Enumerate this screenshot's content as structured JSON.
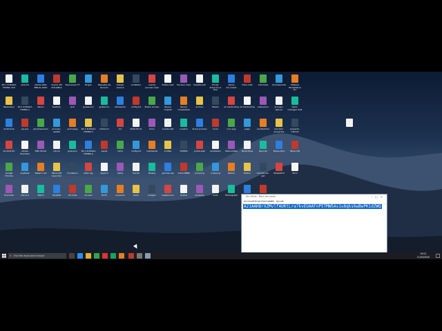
{
  "notepad": {
    "title": "Sin título - Bloc de notas",
    "menus": [
      "Archivo",
      "Edición",
      "Formato",
      "Ver",
      "Ayuda"
    ],
    "text": "A21AAH8rXZMvlfAUKtLra7kvEUAAFnP5TMW5As1u8qkskwBwPK1dZWQ",
    "selected": true
  },
  "taskbar": {
    "search_placeholder": "Escribe aquí para buscar",
    "clock_time": "19:01",
    "clock_date": "11/03/2020"
  },
  "desktop": {
    "wallpaper": "macOS Mojave night",
    "icons": [
      "SD 1.8 MAGIA FOMRA dmt",
      "sara.txt",
      "Adobe After Effects 2020",
      "Oracle VM VirtualBox",
      "Decisiones TT",
      "Brigas",
      "Paquetes de Servicio",
      "trabajo avance",
      "LockRetro",
      "cuenta proceso.mp4",
      "kidfier.mp4",
      "hxcvbvc.mp4",
      "bleeflet.pdf",
      "Enviar Dirección a Rios",
      "danes document",
      "fotos.mp4",
      "tutoriales",
      "Oculosquinta",
      "VMware Workstation Pro",
      "Newonbuy",
      "SD 1.8 MAGIA FOMRA.2",
      "Neuro",
      "Desktop",
      "arch",
      "guisasocio",
      "grabacion",
      "retrasando",
      "config.txt",
      "Buzón Acceso",
      "Nueva carpeta",
      "Nueva completada",
      "archivo",
      "Steam",
      "ok hardcoding",
      "ok.hardcoding",
      "evaluacion",
      "proceso-aplicac",
      "basic-manager.mp4",
      "dvdchamp",
      "pp-pos",
      "gmailresumen",
      "proceso-update",
      "pudvapeg",
      "SD 1.8 MAGIA FOMRA.3",
      "infoturno",
      "bd",
      "2020-05-21",
      "tomo",
      "cuenta-dist",
      "nuestra",
      "dreck-proceso",
      "tucia",
      "icon.png",
      "juego",
      "LandSertice",
      "borrador proyectos",
      "proyecto-tutorial",
      "Acrobat DC",
      "Adobe Premiere",
      "OBS Studio",
      "Canva",
      "guia-proc",
      "SD 1.8 MAGIA FOMRA.4",
      "sayas",
      "lamp",
      "config-bd",
      "cuentasxls",
      "kraftes",
      "TOMMA",
      "proba-web",
      "updatadoc",
      "Web-Ambas",
      "Nada Nova",
      "Recorte",
      "Brave.dmp",
      "Minecraft",
      "Google Chrome",
      "AnyDesk",
      "Steam Link",
      "Minecraft Launcher",
      "Fundasion",
      "latex.log",
      "sayas-2",
      "datos",
      "tienda",
      "fitoshp",
      "pendes-rep",
      "mesh-TBBB",
      "proxy.log",
      "nuha.png",
      "Retirar",
      "Firefox",
      "borradores-ppt",
      "Stopwatch",
      "Xbox",
      "Evernote",
      "Discord",
      "Twitch",
      "WinRAR",
      "VS Code",
      "ax-reso",
      "Mi PC",
      "proyecto",
      "texto",
      "Imagen",
      "nuestra-nov",
      "Grabar",
      "armados",
      "sudo",
      "Phonograph",
      "Iniciar",
      "Aur"
    ]
  }
}
